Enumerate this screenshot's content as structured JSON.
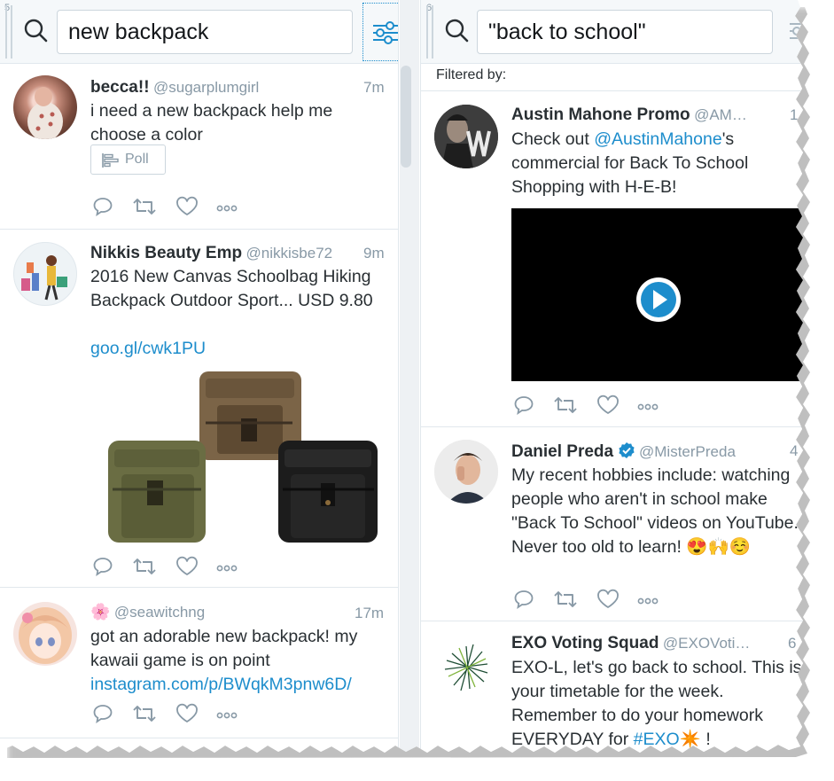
{
  "column5": {
    "number": "5",
    "search_value": "new backpack",
    "tweets": [
      {
        "name": "becca!!",
        "handle": "@sugarplumgirl",
        "time": "7m",
        "text": "i need a new backpack help me choose a color",
        "poll_label": "Poll"
      },
      {
        "name": "Nikkis Beauty Emp",
        "handle": "@nikkisbe72",
        "time": "9m",
        "text": "2016 New Canvas Schoolbag Hiking Backpack Outdoor Sport... USD 9.80",
        "link": "goo.gl/cwk1PU"
      },
      {
        "name_emoji": "🌸",
        "handle": "@seawitchng",
        "time": "17m",
        "text": "got an adorable new backpack! my kawaii game is on point",
        "link": "instagram.com/p/BWqkM3pnw6D/"
      }
    ]
  },
  "column6": {
    "number": "6",
    "search_value": "\"back to school\"",
    "filtered_label": "Filtered by:",
    "tweets": [
      {
        "name": "Austin Mahone Promo",
        "handle": "@AM…",
        "time": "1",
        "text_pre": "Check out ",
        "mention": "@AustinMahone",
        "text_post": "'s commercial for Back To School Shopping with H-E-B!"
      },
      {
        "name": "Daniel Preda",
        "handle": "@MisterPreda",
        "time": "4",
        "verified": true,
        "text": "My recent hobbies include: watching people who aren't in school make \"Back To School\" videos on YouTube. Never too old to learn! 😍🙌☺️"
      },
      {
        "name": "EXO Voting Squad",
        "handle": "@EXOVoti…",
        "time": "6",
        "text_pre": "EXO-L, let's go back to school. This is your timetable for the week. Remember to do your homework EVERYDAY for ",
        "hashtag": "#EXO",
        "text_post": "✴️ !"
      }
    ]
  },
  "icons": {
    "search": "search-icon",
    "filter": "sliders-icon",
    "reply": "reply-icon",
    "retweet": "retweet-icon",
    "like": "heart-icon",
    "more": "more-icon",
    "play": "play-icon",
    "verified": "verified-badge-icon",
    "poll": "poll-icon"
  },
  "colors": {
    "accent": "#1d8dcc",
    "muted": "#8899a6",
    "text": "#292f33",
    "header_bg": "#f5f8fa"
  }
}
